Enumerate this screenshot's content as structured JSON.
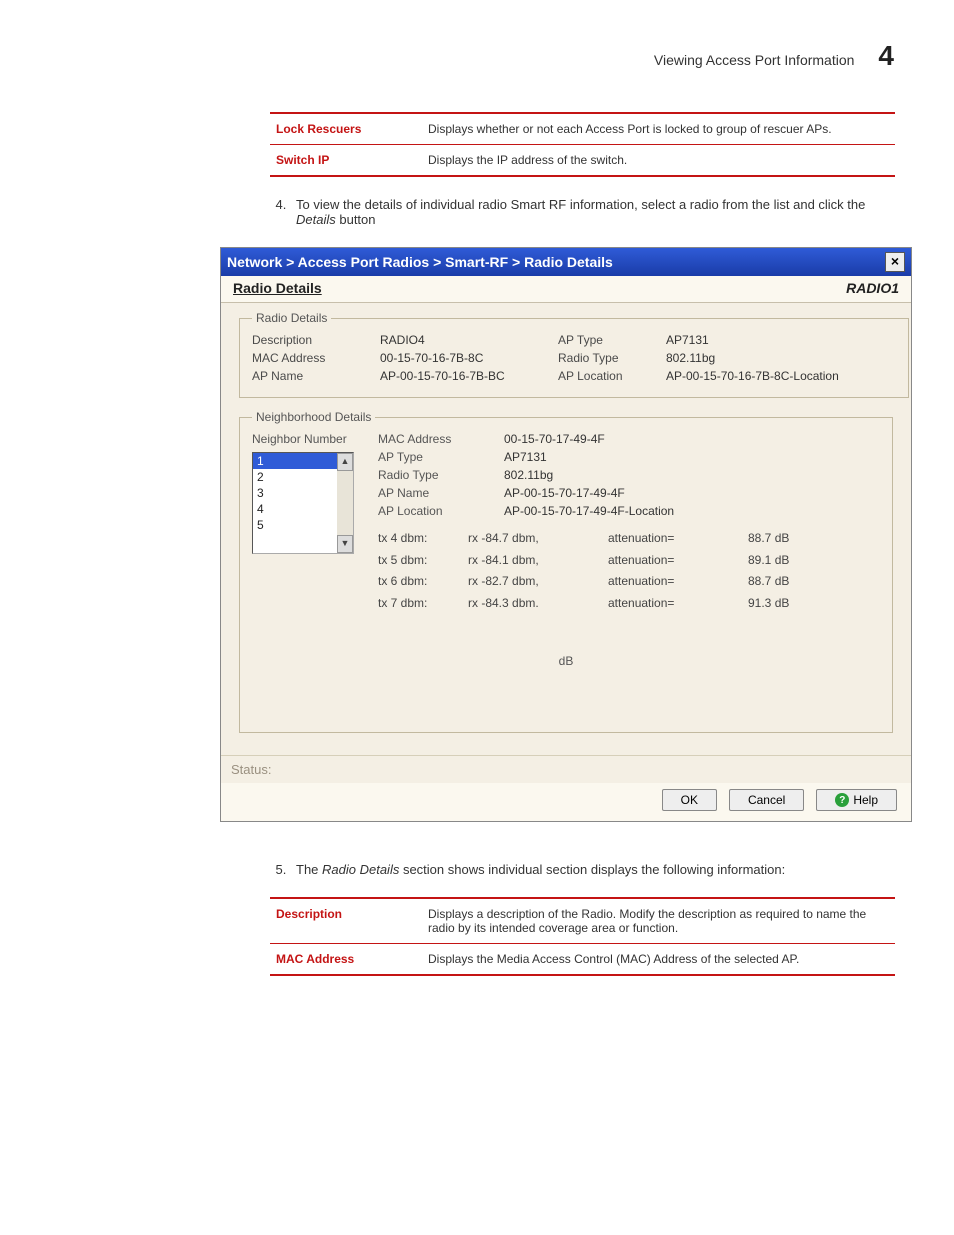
{
  "page": {
    "header_title": "Viewing Access Port Information",
    "header_number": "4"
  },
  "top_table": [
    {
      "label": "Lock Rescuers",
      "desc": "Displays whether or not each Access Port is locked to group of rescuer APs."
    },
    {
      "label": "Switch IP",
      "desc": "Displays the IP address of the switch."
    }
  ],
  "step4": {
    "num": "4.",
    "text_before": "To view the details of individual radio Smart RF information, select a radio from the list and click the ",
    "button_name": "Details",
    "text_after": " button"
  },
  "dialog": {
    "breadcrumb": [
      "Network",
      "Access Port Radios",
      "Smart-RF",
      "Radio Details"
    ],
    "breadcrumb_sep": " > ",
    "sub_title": "Radio Details",
    "radio_label": "RADIO1",
    "radio_details_legend": "Radio  Details",
    "radio_fields": {
      "Description": "RADIO4",
      "MAC Address": "00-15-70-16-7B-8C",
      "AP Name": "AP-00-15-70-16-7B-BC",
      "AP Type": "AP7131",
      "Radio Type": "802.11bg",
      "AP Location": "AP-00-15-70-16-7B-8C-Location"
    },
    "neighborhood_legend": "Neighborhood  Details",
    "neighbor_number_label": "Neighbor Number",
    "neighbor_numbers": [
      "1",
      "2",
      "3",
      "4",
      "5"
    ],
    "neighbor_selected": "1",
    "neighbor_fields": {
      "MAC Address": "00-15-70-17-49-4F",
      "AP Type": "AP7131",
      "Radio Type": "802.11bg",
      "AP Name": "AP-00-15-70-17-49-4F",
      "AP Location": "AP-00-15-70-17-49-4F-Location"
    },
    "tx_rows": [
      {
        "tx": "tx   4 dbm:",
        "rx": "rx     -84.7 dbm,",
        "att": "attenuation=",
        "db": "88.7  dB"
      },
      {
        "tx": "tx   5 dbm:",
        "rx": "rx     -84.1 dbm,",
        "att": "attenuation=",
        "db": "89.1  dB"
      },
      {
        "tx": "tx   6 dbm:",
        "rx": "rx     -82.7 dbm,",
        "att": "attenuation=",
        "db": "88.7  dB"
      },
      {
        "tx": "tx   7 dbm:",
        "rx": "rx     -84.3 dbm.",
        "att": "attenuation=",
        "db": "91.3  dB"
      }
    ],
    "db_label": "dB",
    "status_label": "Status:",
    "buttons": {
      "ok": "OK",
      "cancel": "Cancel",
      "help": "Help"
    }
  },
  "step5": {
    "num": "5.",
    "text_before": "The ",
    "italic": "Radio Details",
    "text_after": " section shows individual section displays the following information:"
  },
  "bottom_table": [
    {
      "label": "Description",
      "desc": "Displays a description of the Radio. Modify the description as required to name the radio by its intended coverage area or function."
    },
    {
      "label": "MAC Address",
      "desc": "Displays the Media Access Control (MAC) Address of the selected AP."
    }
  ]
}
